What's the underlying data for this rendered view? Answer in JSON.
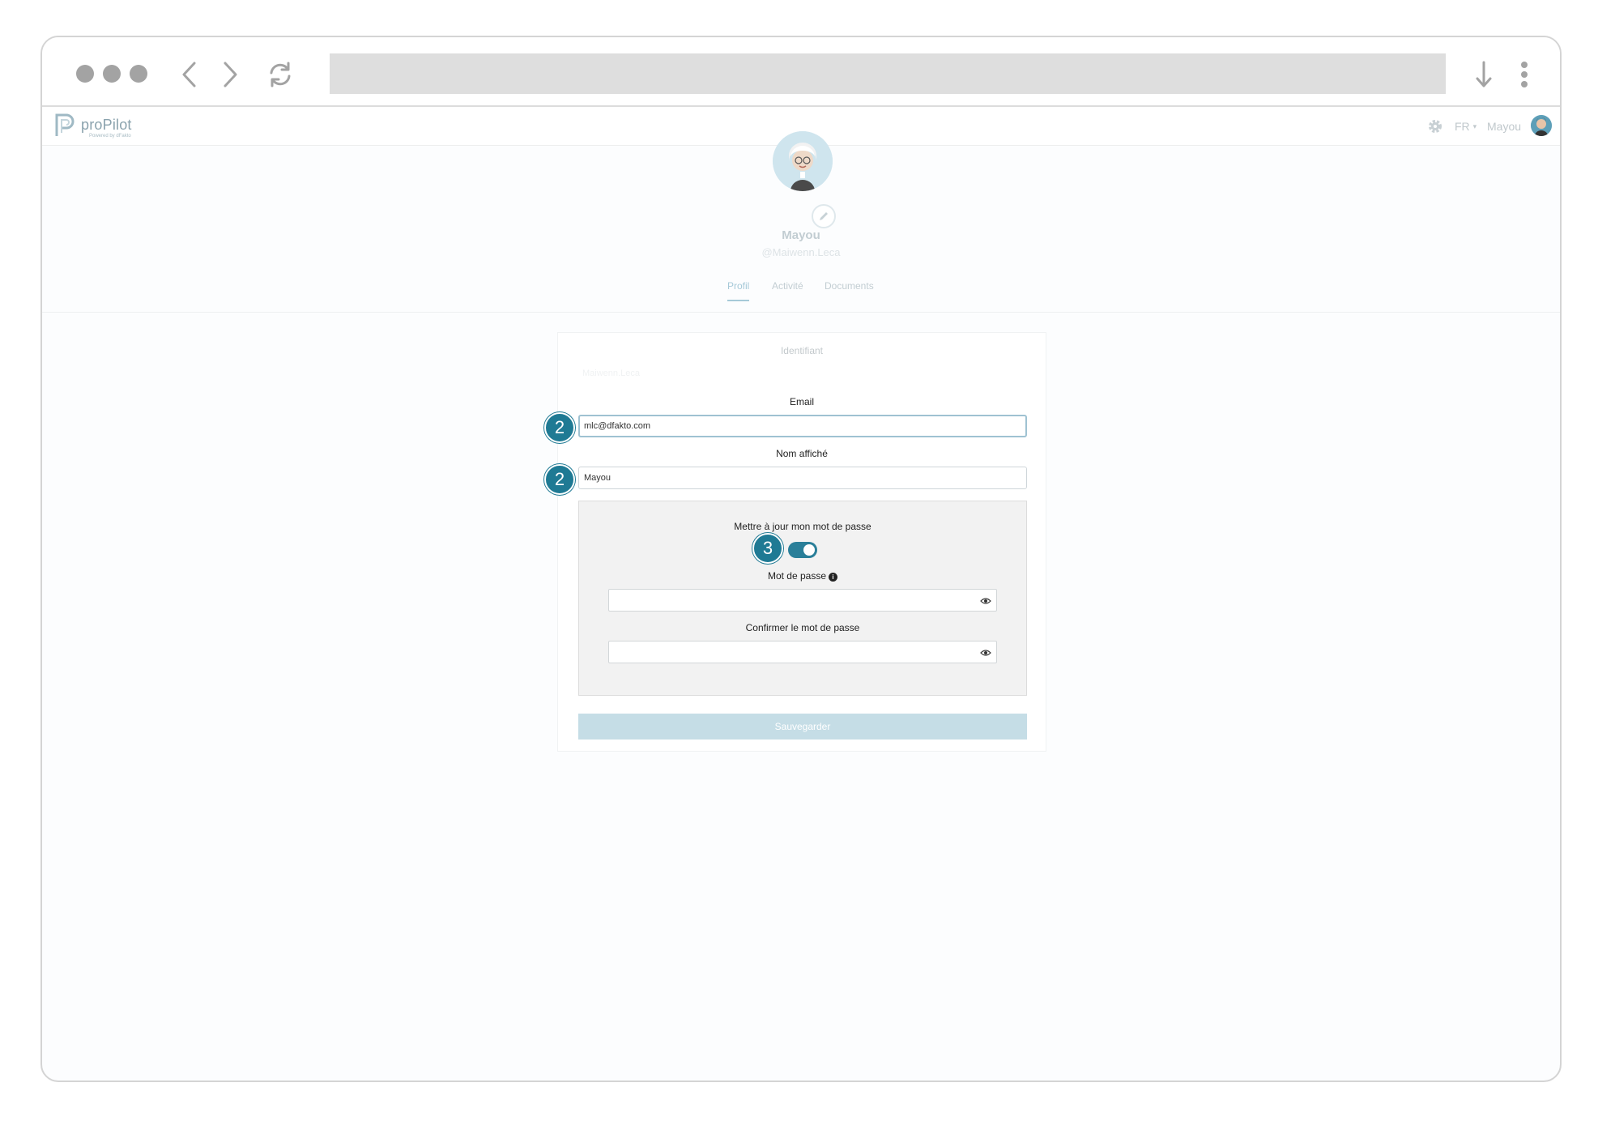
{
  "app": {
    "name": "proPilot",
    "tagline": "Powered by dFakto"
  },
  "header": {
    "language": "FR",
    "user_name": "Mayou"
  },
  "profile": {
    "display_name": "Mayou",
    "handle": "@Maiwenn.Leca"
  },
  "tabs": [
    {
      "label": "Profil",
      "active": true
    },
    {
      "label": "Activité",
      "active": false
    },
    {
      "label": "Documents",
      "active": false
    }
  ],
  "form": {
    "identifier_label": "Identifiant",
    "identifier_value": "Maiwenn.Leca",
    "email_label": "Email",
    "email_value": "mlc@dfakto.com",
    "display_name_label": "Nom affiché",
    "display_name_value": "Mayou",
    "password_toggle_label": "Mettre à jour mon mot de passe",
    "password_toggle_on": true,
    "password_label": "Mot de passe",
    "confirm_password_label": "Confirmer le mot de passe",
    "save_label": "Sauvegarder"
  },
  "markers": {
    "email": "2",
    "display_name": "2",
    "toggle": "3"
  },
  "colors": {
    "accent": "#1f7a94",
    "accent_light": "#a6c9d8",
    "save_disabled": "#c5dde6"
  }
}
